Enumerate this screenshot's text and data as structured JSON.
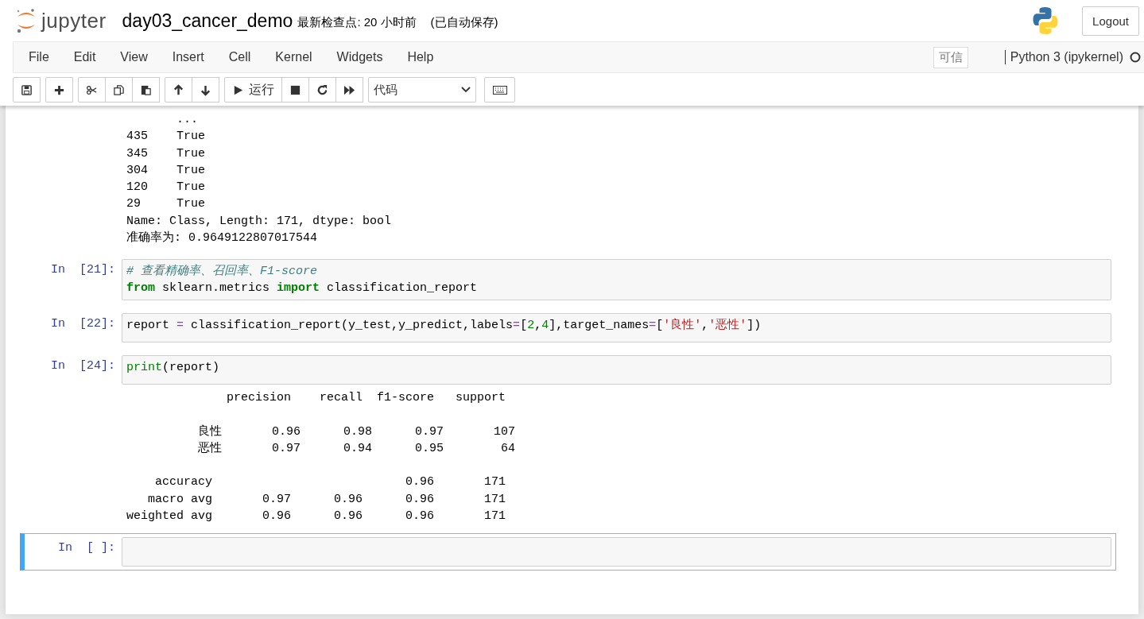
{
  "header": {
    "logo_text": "jupyter",
    "notebook_name": "day03_cancer_demo",
    "checkpoint": "最新检查点: 20 小时前",
    "autosave": "(已自动保存)",
    "logout": "Logout"
  },
  "menu": [
    "File",
    "Edit",
    "View",
    "Insert",
    "Cell",
    "Kernel",
    "Widgets",
    "Help"
  ],
  "trusted": "可信",
  "kernel_name": "Python 3 (ipykernel)",
  "toolbar": [
    [
      {
        "kind": "save"
      }
    ],
    [
      {
        "kind": "add"
      }
    ],
    [
      {
        "kind": "cut"
      },
      {
        "kind": "copy"
      },
      {
        "kind": "paste"
      }
    ],
    [
      {
        "kind": "up"
      },
      {
        "kind": "down"
      }
    ],
    [
      {
        "kind": "run",
        "label": "运行"
      },
      {
        "kind": "stop"
      },
      {
        "kind": "restart"
      },
      {
        "kind": "fast-forward"
      }
    ]
  ],
  "cell_type": "代码",
  "cells": [
    {
      "selected": false,
      "output": [
        [
          "       ...",
          "435    True",
          "345    True",
          "304    True",
          "120    True",
          "29     True",
          "Name: Class, Length: 171, dtype: bool",
          "准确率为: 0.9649122807017544"
        ]
      ]
    },
    {
      "selected": false,
      "prompt": "In  [21]:",
      "input": [
        [
          {
            "text": "# 查看精确率、召回率、F1-score",
            "kind": "comment"
          }
        ],
        [
          {
            "text": "from",
            "kind": "keyword"
          },
          {
            "text": " sklearn.metrics ",
            "kind": "plain"
          },
          {
            "text": "import",
            "kind": "keyword"
          },
          {
            "text": " classification_report",
            "kind": "plain"
          }
        ]
      ]
    },
    {
      "selected": false,
      "prompt": "In  [22]:",
      "input": [
        [
          {
            "text": "report ",
            "kind": "plain"
          },
          {
            "text": "=",
            "kind": "operator"
          },
          {
            "text": " classification_report(y_test,y_predict,labels",
            "kind": "plain"
          },
          {
            "text": "=",
            "kind": "operator"
          },
          {
            "text": "[",
            "kind": "plain"
          },
          {
            "text": "2",
            "kind": "number"
          },
          {
            "text": ",",
            "kind": "plain"
          },
          {
            "text": "4",
            "kind": "number"
          },
          {
            "text": "],target_names",
            "kind": "plain"
          },
          {
            "text": "=",
            "kind": "operator"
          },
          {
            "text": "[",
            "kind": "plain"
          },
          {
            "text": "'良性'",
            "kind": "string"
          },
          {
            "text": ",",
            "kind": "plain"
          },
          {
            "text": "'恶性'",
            "kind": "string"
          },
          {
            "text": "])",
            "kind": "plain"
          }
        ]
      ]
    },
    {
      "selected": false,
      "prompt": "In  [24]:",
      "input": [
        [
          {
            "text": "print",
            "kind": "builtin"
          },
          {
            "text": "(report)",
            "kind": "plain"
          }
        ]
      ],
      "output": [
        [
          "              precision    recall  f1-score   support"
        ],
        [
          "          良性       0.96      0.98      0.97       107",
          "          恶性       0.97      0.94      0.95        64"
        ],
        [
          "    accuracy                           0.96       171",
          "   macro avg       0.97      0.96      0.96       171",
          "weighted avg       0.96      0.96      0.96       171"
        ]
      ]
    },
    {
      "selected": true,
      "prompt": "In  [ ]:"
    }
  ]
}
